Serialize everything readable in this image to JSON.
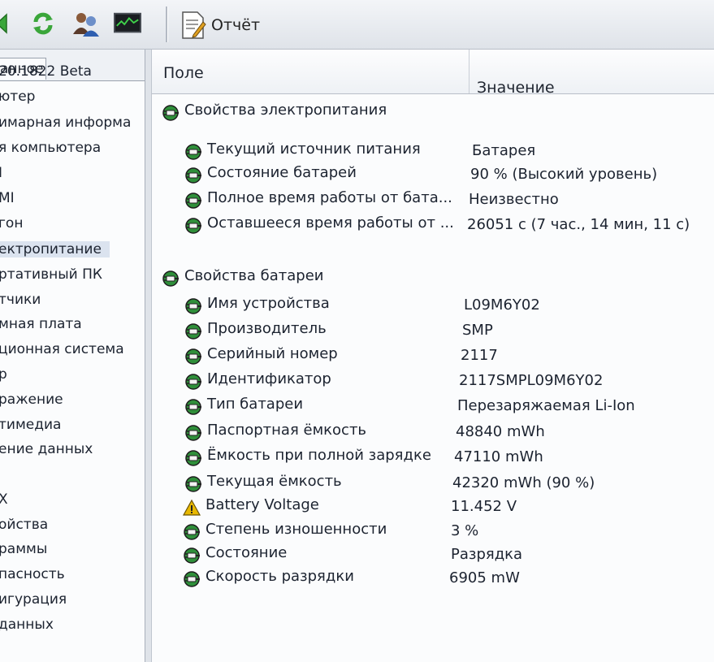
{
  "toolbar": {
    "report_label": "Отчёт"
  },
  "left_panel": {
    "tab_label": "анное",
    "items": [
      "20.1822 Beta",
      "ютер",
      "имарная информа",
      "я компьютера",
      "I",
      "MI",
      "гон",
      "ектропитание",
      "ртативный ПК",
      "тчики",
      "мная плата",
      "ционная система",
      "р",
      "ражение",
      "тимедиа",
      "ение данных",
      "",
      "X",
      "ойства",
      "раммы",
      "пасность",
      "игурация",
      "данных"
    ],
    "selected_index": 7
  },
  "columns": {
    "field": "Поле",
    "value": "Значение"
  },
  "sections": [
    {
      "title": "Свойства электропитания",
      "rows": [
        {
          "field": "Текущий источник питания",
          "value": "Батарея",
          "icon": "plug-icon"
        },
        {
          "field": "Состояние батарей",
          "value": "90 % (Высокий уровень)",
          "icon": "plug-icon"
        },
        {
          "field": "Полное время работы от бата...",
          "value": "Неизвестно",
          "icon": "plug-icon"
        },
        {
          "field": "Оставшееся время работы от ...",
          "value": "26051 с (7 час., 14 мин, 11 с)",
          "icon": "plug-icon"
        }
      ]
    },
    {
      "title": "Свойства батареи",
      "rows": [
        {
          "field": "Имя устройства",
          "value": "L09M6Y02",
          "icon": "plug-icon"
        },
        {
          "field": "Производитель",
          "value": "SMP",
          "icon": "plug-icon"
        },
        {
          "field": "Серийный номер",
          "value": "2117",
          "icon": "plug-icon"
        },
        {
          "field": "Идентификатор",
          "value": "2117SMPL09M6Y02",
          "icon": "plug-icon"
        },
        {
          "field": "Тип батареи",
          "value": "Перезаряжаемая Li-Ion",
          "icon": "plug-icon"
        },
        {
          "field": "Паспортная ёмкость",
          "value": "48840 mWh",
          "icon": "plug-icon"
        },
        {
          "field": "Ёмкость при полной зарядке",
          "value": "47110 mWh",
          "icon": "plug-icon"
        },
        {
          "field": "Текущая ёмкость",
          "value": "42320 mWh  (90 %)",
          "icon": "plug-icon"
        },
        {
          "field": "Battery Voltage",
          "value": "11.452 V",
          "icon": "warning-icon"
        },
        {
          "field": "Степень изношенности",
          "value": "3 %",
          "icon": "plug-icon"
        },
        {
          "field": "Состояние",
          "value": "Разрядка",
          "icon": "plug-icon"
        },
        {
          "field": "Скорость разрядки",
          "value": "6905 mW",
          "icon": "plug-icon"
        }
      ]
    }
  ],
  "colors": {
    "plug_green": "#2f8f3a",
    "warning_yellow": "#e8b800"
  }
}
